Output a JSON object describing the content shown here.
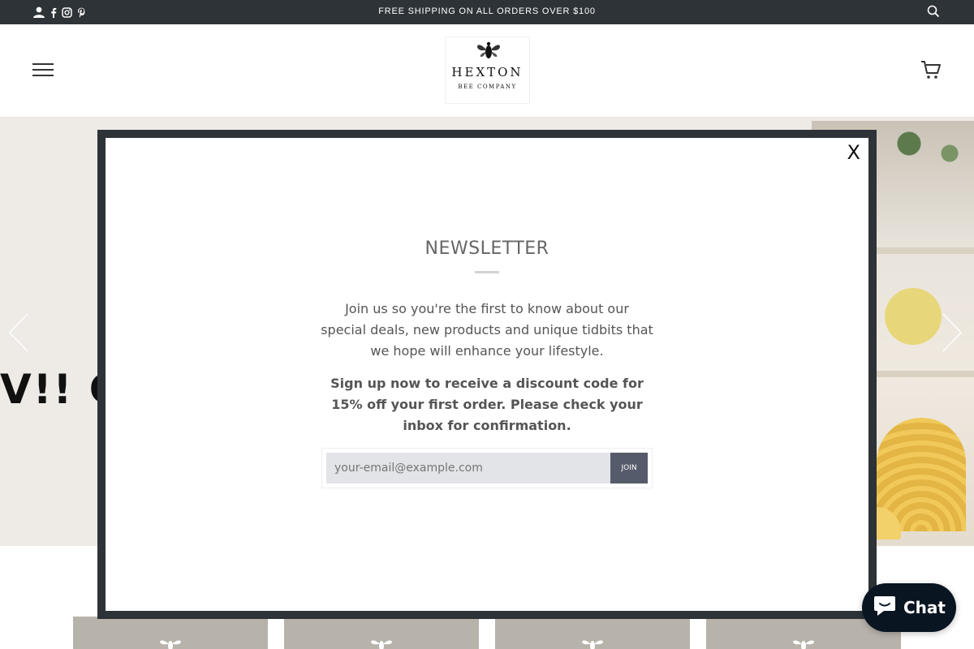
{
  "topbar": {
    "announcement": "FREE SHIPPING ON ALL ORDERS OVER $100",
    "icons": [
      "user-icon",
      "facebook-icon",
      "instagram-icon",
      "pinterest-icon",
      "search-icon"
    ]
  },
  "header": {
    "logo_word": "HEXTON",
    "logo_sub": "BEE COMPANY",
    "icons": [
      "menu-icon",
      "cart-icon"
    ]
  },
  "hero": {
    "overlay_text": "V!! C",
    "icons": [
      "chevron-left-icon",
      "chevron-right-icon"
    ]
  },
  "modal": {
    "close_label": "X",
    "title": "NEWSLETTER",
    "body": "Join us so you're the first to know about our special deals, new products and unique tidbits that we hope will enhance your lifestyle.",
    "bold_body": "Sign up now to receive a discount code for 15% off your first order. Please check your inbox for confirmation.",
    "email_placeholder": "your-email@example.com",
    "join_label": "JOIN"
  },
  "chat": {
    "label": "Chat",
    "icon": "chat-bubble-icon"
  },
  "colors": {
    "topbar_bg": "#2e3338",
    "modal_frame": "#2e3338",
    "join_button": "#565b6b",
    "chat_bg": "#0a1522"
  }
}
